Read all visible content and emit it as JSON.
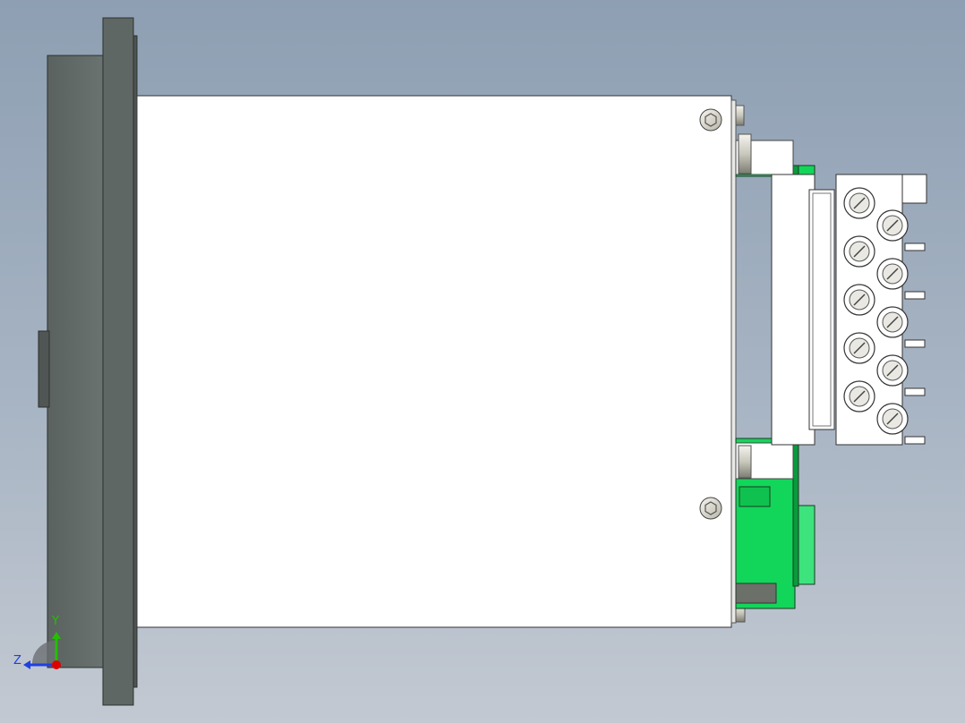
{
  "viewport": {
    "background_top": "#8e9fb3",
    "background_bottom": "#c3c9d2"
  },
  "model": {
    "front_bezel_color": "#5f6764",
    "housing_color": "#ffffff",
    "pcb_color": "#12d65a",
    "terminal_color": "#ffffff",
    "terminal_screw_rows": 5,
    "terminal_screw_columns": 2,
    "rod_icon": "threaded-rod",
    "screw_icon": "torx-screw"
  },
  "triad": {
    "y_label": "Y",
    "z_label": "Z",
    "y_color": "#22c000",
    "z_color": "#2040e0",
    "x_color": "#e00000"
  }
}
